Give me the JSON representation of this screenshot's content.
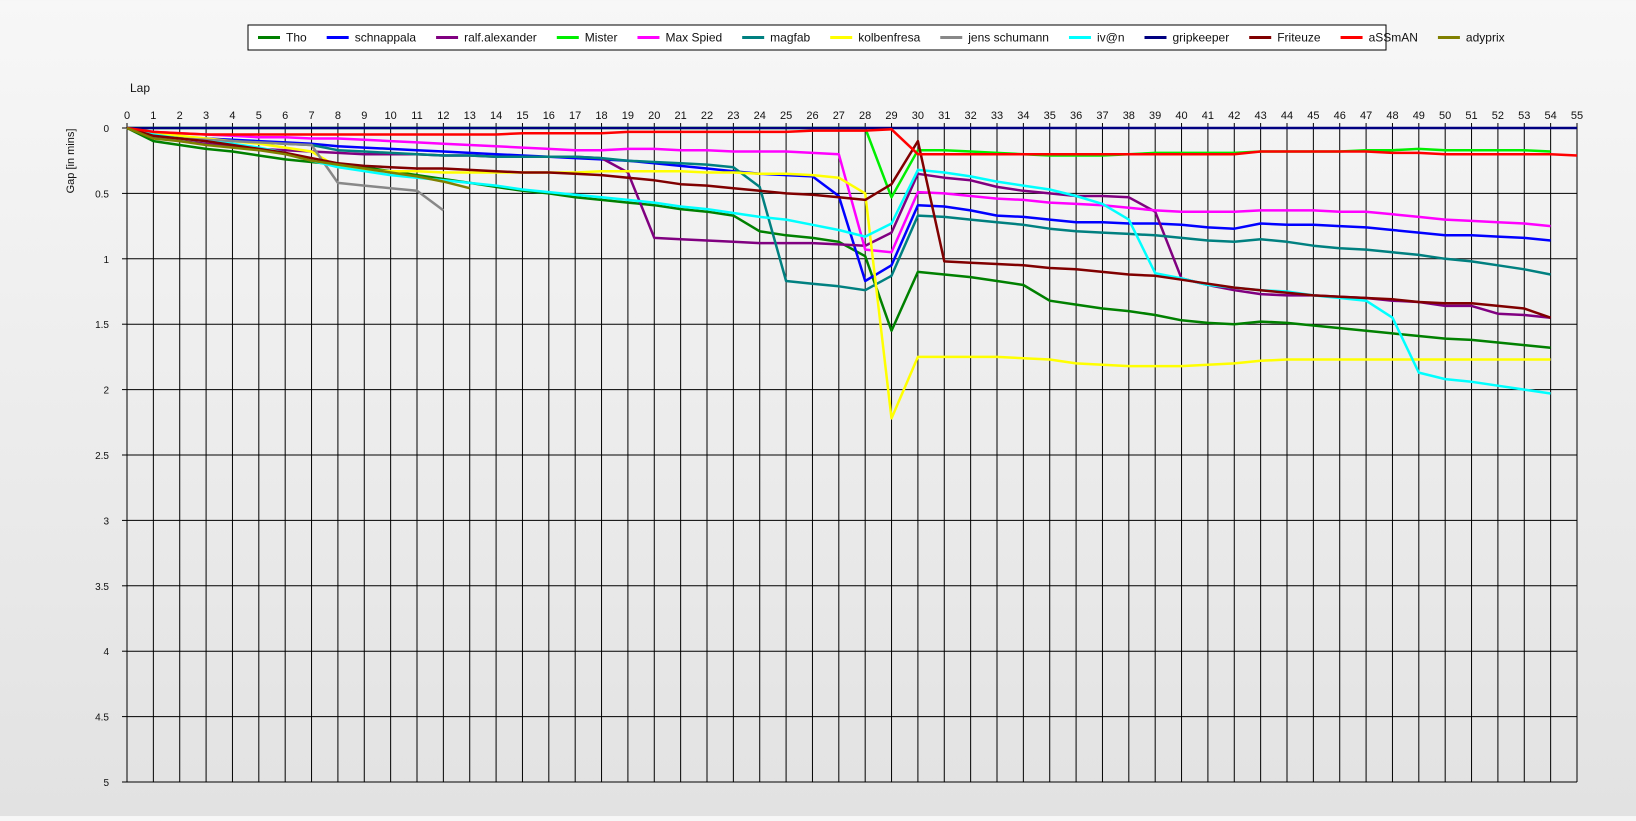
{
  "chart_data": {
    "type": "line",
    "xlabel": "Lap",
    "ylabel": "Gap [in mins]",
    "xlim": [
      0,
      55
    ],
    "ylim": [
      0,
      5
    ],
    "y_inverted": true,
    "x_ticks": [
      0,
      1,
      2,
      3,
      4,
      5,
      6,
      7,
      8,
      9,
      10,
      11,
      12,
      13,
      14,
      15,
      16,
      17,
      18,
      19,
      20,
      21,
      22,
      23,
      24,
      25,
      26,
      27,
      28,
      29,
      30,
      31,
      32,
      33,
      34,
      35,
      36,
      37,
      38,
      39,
      40,
      41,
      42,
      43,
      44,
      45,
      46,
      47,
      48,
      49,
      50,
      51,
      52,
      53,
      54,
      55
    ],
    "y_ticks": [
      0,
      0.5,
      1,
      1.5,
      2,
      2.5,
      3,
      3.5,
      4,
      4.5,
      5
    ],
    "y_tick_labels": [
      "0",
      "0.5",
      "1",
      "1.5",
      "2",
      "2.5",
      "3",
      "3.5",
      "4",
      "4.5",
      "5"
    ],
    "grid": true,
    "legend_position": "top-center",
    "series": [
      {
        "name": "Tho",
        "color": "#008000",
        "values": [
          0,
          0.1,
          0.13,
          0.16,
          0.18,
          0.21,
          0.24,
          0.26,
          0.28,
          0.3,
          0.33,
          0.36,
          0.39,
          0.42,
          0.45,
          0.48,
          0.5,
          0.53,
          0.55,
          0.57,
          0.59,
          0.62,
          0.64,
          0.67,
          0.79,
          0.82,
          0.84,
          0.87,
          0.98,
          1.55,
          1.1,
          1.12,
          1.14,
          1.17,
          1.2,
          1.32,
          1.35,
          1.38,
          1.4,
          1.43,
          1.47,
          1.49,
          1.5,
          1.48,
          1.49,
          1.51,
          1.53,
          1.55,
          1.57,
          1.59,
          1.61,
          1.62,
          1.64,
          1.66,
          1.68
        ]
      },
      {
        "name": "schnappala",
        "color": "#0000ff",
        "values": [
          0,
          0.05,
          0.07,
          0.08,
          0.09,
          0.1,
          0.11,
          0.12,
          0.14,
          0.15,
          0.16,
          0.17,
          0.18,
          0.19,
          0.2,
          0.21,
          0.22,
          0.23,
          0.24,
          0.25,
          0.27,
          0.29,
          0.31,
          0.33,
          0.35,
          0.36,
          0.37,
          0.52,
          1.17,
          1.05,
          0.59,
          0.6,
          0.63,
          0.67,
          0.68,
          0.7,
          0.72,
          0.72,
          0.73,
          0.73,
          0.74,
          0.76,
          0.77,
          0.73,
          0.74,
          0.74,
          0.75,
          0.76,
          0.78,
          0.8,
          0.82,
          0.82,
          0.83,
          0.84,
          0.86
        ]
      },
      {
        "name": "ralf.alexander",
        "color": "#800080",
        "values": [
          0,
          0.07,
          0.1,
          0.12,
          0.14,
          0.16,
          0.17,
          0.18,
          0.19,
          0.2,
          0.2,
          0.2,
          0.21,
          0.21,
          0.22,
          0.22,
          0.22,
          0.22,
          0.23,
          0.34,
          0.84,
          0.85,
          0.86,
          0.87,
          0.88,
          0.88,
          0.88,
          0.89,
          0.9,
          0.8,
          0.35,
          0.38,
          0.4,
          0.45,
          0.48,
          0.5,
          0.52,
          0.52,
          0.53,
          0.64,
          1.15,
          1.2,
          1.24,
          1.27,
          1.28,
          1.28,
          1.29,
          1.3,
          1.32,
          1.33,
          1.36,
          1.36,
          1.42,
          1.43,
          1.45
        ]
      },
      {
        "name": "Mister",
        "color": "#00ee00",
        "values": [
          0,
          0,
          0,
          0,
          0,
          0,
          0,
          0,
          0,
          0,
          0,
          0,
          0,
          0,
          0,
          0,
          0,
          0,
          0,
          0,
          0,
          0,
          0,
          0,
          0,
          0,
          0,
          0,
          0,
          0.53,
          0.17,
          0.17,
          0.18,
          0.19,
          0.2,
          0.21,
          0.21,
          0.21,
          0.2,
          0.19,
          0.19,
          0.19,
          0.19,
          0.18,
          0.18,
          0.18,
          0.18,
          0.17,
          0.17,
          0.16,
          0.17,
          0.17,
          0.17,
          0.17,
          0.18
        ]
      },
      {
        "name": "Max Spied",
        "color": "#ff00ff",
        "values": [
          0,
          0.03,
          0.04,
          0.05,
          0.06,
          0.07,
          0.07,
          0.08,
          0.08,
          0.09,
          0.1,
          0.11,
          0.12,
          0.13,
          0.14,
          0.15,
          0.16,
          0.17,
          0.17,
          0.16,
          0.16,
          0.17,
          0.17,
          0.18,
          0.18,
          0.18,
          0.19,
          0.2,
          0.93,
          0.95,
          0.49,
          0.5,
          0.52,
          0.54,
          0.55,
          0.57,
          0.58,
          0.59,
          0.61,
          0.63,
          0.64,
          0.64,
          0.64,
          0.63,
          0.63,
          0.63,
          0.64,
          0.64,
          0.66,
          0.68,
          0.7,
          0.71,
          0.72,
          0.73,
          0.75
        ]
      },
      {
        "name": "magfab",
        "color": "#008080",
        "values": [
          0,
          0.06,
          0.08,
          0.09,
          0.1,
          0.11,
          0.12,
          0.13,
          0.17,
          0.18,
          0.19,
          0.2,
          0.21,
          0.21,
          0.22,
          0.22,
          0.22,
          0.22,
          0.23,
          0.25,
          0.26,
          0.27,
          0.28,
          0.3,
          0.45,
          1.17,
          1.19,
          1.21,
          1.24,
          1.13,
          0.67,
          0.68,
          0.7,
          0.72,
          0.74,
          0.77,
          0.79,
          0.8,
          0.81,
          0.82,
          0.84,
          0.86,
          0.87,
          0.85,
          0.87,
          0.9,
          0.92,
          0.93,
          0.95,
          0.97,
          1.0,
          1.02,
          1.05,
          1.08,
          1.12
        ]
      },
      {
        "name": "kolbenfresa",
        "color": "#ffff00",
        "values": [
          0,
          0.04,
          0.06,
          0.08,
          0.1,
          0.12,
          0.15,
          0.18,
          0.3,
          0.32,
          0.33,
          0.33,
          0.34,
          0.34,
          0.34,
          0.34,
          0.34,
          0.34,
          0.33,
          0.33,
          0.33,
          0.33,
          0.34,
          0.34,
          0.35,
          0.35,
          0.36,
          0.38,
          0.5,
          2.22,
          1.75,
          1.75,
          1.75,
          1.75,
          1.76,
          1.77,
          1.8,
          1.81,
          1.82,
          1.82,
          1.82,
          1.81,
          1.8,
          1.78,
          1.77,
          1.77,
          1.77,
          1.77,
          1.77,
          1.77,
          1.77,
          1.77,
          1.77,
          1.77,
          1.77
        ]
      },
      {
        "name": "jens  schumann",
        "color": "#888888",
        "values": [
          0,
          0.06,
          0.08,
          0.09,
          0.1,
          0.11,
          0.12,
          0.13,
          0.42,
          0.44,
          0.46,
          0.48,
          0.63
        ]
      },
      {
        "name": "iv@n",
        "color": "#00ffff",
        "values": [
          0,
          0.05,
          0.08,
          0.1,
          0.12,
          0.15,
          0.19,
          0.25,
          0.3,
          0.33,
          0.36,
          0.38,
          0.4,
          0.42,
          0.44,
          0.47,
          0.49,
          0.51,
          0.53,
          0.55,
          0.57,
          0.6,
          0.62,
          0.65,
          0.68,
          0.7,
          0.74,
          0.78,
          0.83,
          0.73,
          0.32,
          0.34,
          0.37,
          0.41,
          0.44,
          0.47,
          0.52,
          0.58,
          0.7,
          1.11,
          1.15,
          1.2,
          1.22,
          1.24,
          1.25,
          1.28,
          1.3,
          1.32,
          1.45,
          1.87,
          1.92,
          1.94,
          1.97,
          2.0,
          2.03
        ]
      },
      {
        "name": "gripkeeper",
        "color": "#000080",
        "values": [
          0,
          0,
          0,
          0,
          0,
          0,
          0,
          0,
          0,
          0,
          0,
          0,
          0,
          0,
          0,
          0,
          0,
          0,
          0,
          0,
          0,
          0,
          0,
          0,
          0,
          0,
          0,
          0,
          0,
          0,
          0,
          0,
          0,
          0,
          0,
          0,
          0,
          0,
          0,
          0,
          0,
          0,
          0,
          0,
          0,
          0,
          0,
          0,
          0,
          0,
          0,
          0,
          0,
          0,
          0,
          0
        ]
      },
      {
        "name": "Friteuze",
        "color": "#800000",
        "values": [
          0,
          0.06,
          0.08,
          0.1,
          0.13,
          0.16,
          0.19,
          0.23,
          0.27,
          0.29,
          0.3,
          0.31,
          0.31,
          0.32,
          0.33,
          0.34,
          0.34,
          0.35,
          0.36,
          0.38,
          0.4,
          0.43,
          0.44,
          0.46,
          0.48,
          0.5,
          0.51,
          0.53,
          0.55,
          0.43,
          0.1,
          1.02,
          1.03,
          1.04,
          1.05,
          1.07,
          1.08,
          1.1,
          1.12,
          1.13,
          1.16,
          1.19,
          1.22,
          1.24,
          1.26,
          1.28,
          1.29,
          1.3,
          1.31,
          1.33,
          1.34,
          1.34,
          1.36,
          1.38,
          1.45
        ]
      },
      {
        "name": "aSSmAN",
        "color": "#ff0000",
        "values": [
          0,
          0.03,
          0.04,
          0.05,
          0.05,
          0.05,
          0.05,
          0.05,
          0.05,
          0.05,
          0.05,
          0.05,
          0.05,
          0.05,
          0.05,
          0.04,
          0.04,
          0.04,
          0.04,
          0.03,
          0.03,
          0.03,
          0.03,
          0.03,
          0.03,
          0.03,
          0.02,
          0.02,
          0.02,
          0.01,
          0.2,
          0.2,
          0.2,
          0.2,
          0.2,
          0.2,
          0.2,
          0.2,
          0.2,
          0.2,
          0.2,
          0.2,
          0.2,
          0.18,
          0.18,
          0.18,
          0.18,
          0.18,
          0.19,
          0.19,
          0.2,
          0.2,
          0.2,
          0.2,
          0.2,
          0.21
        ]
      },
      {
        "name": "adyprix",
        "color": "#808000",
        "values": [
          0,
          0.08,
          0.1,
          0.13,
          0.15,
          0.17,
          0.2,
          0.25,
          0.28,
          0.31,
          0.34,
          0.37,
          0.41,
          0.46
        ]
      }
    ]
  }
}
